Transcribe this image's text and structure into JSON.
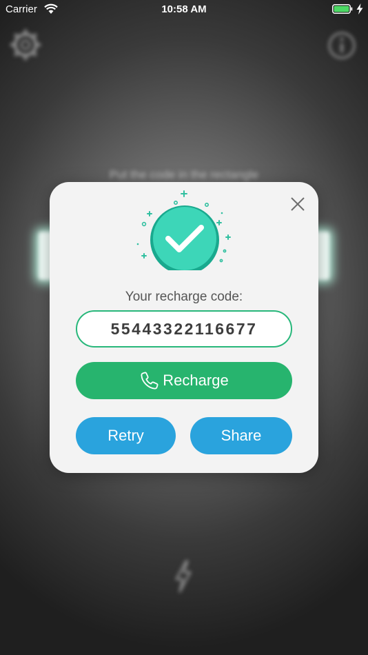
{
  "status_bar": {
    "carrier": "Carrier",
    "time": "10:58 AM",
    "icons": [
      "wifi-icon",
      "battery-icon",
      "charging-bolt-icon"
    ]
  },
  "background": {
    "instruction": "Put the code in the rectangle",
    "icons": [
      "settings-icon",
      "info-icon",
      "flash-icon"
    ]
  },
  "modal": {
    "code_label": "Your recharge code:",
    "code_value": "55443322116677",
    "recharge_label": "Recharge",
    "retry_label": "Retry",
    "share_label": "Share",
    "icons": [
      "close-icon",
      "success-check-icon",
      "phone-icon"
    ]
  },
  "colors": {
    "success_teal": "#3dd6b8",
    "recharge_green": "#27b46e",
    "action_blue": "#2aa3dd",
    "code_border": "#27b77a",
    "modal_bg": "#f3f3f3",
    "battery_green": "#4cd964"
  }
}
